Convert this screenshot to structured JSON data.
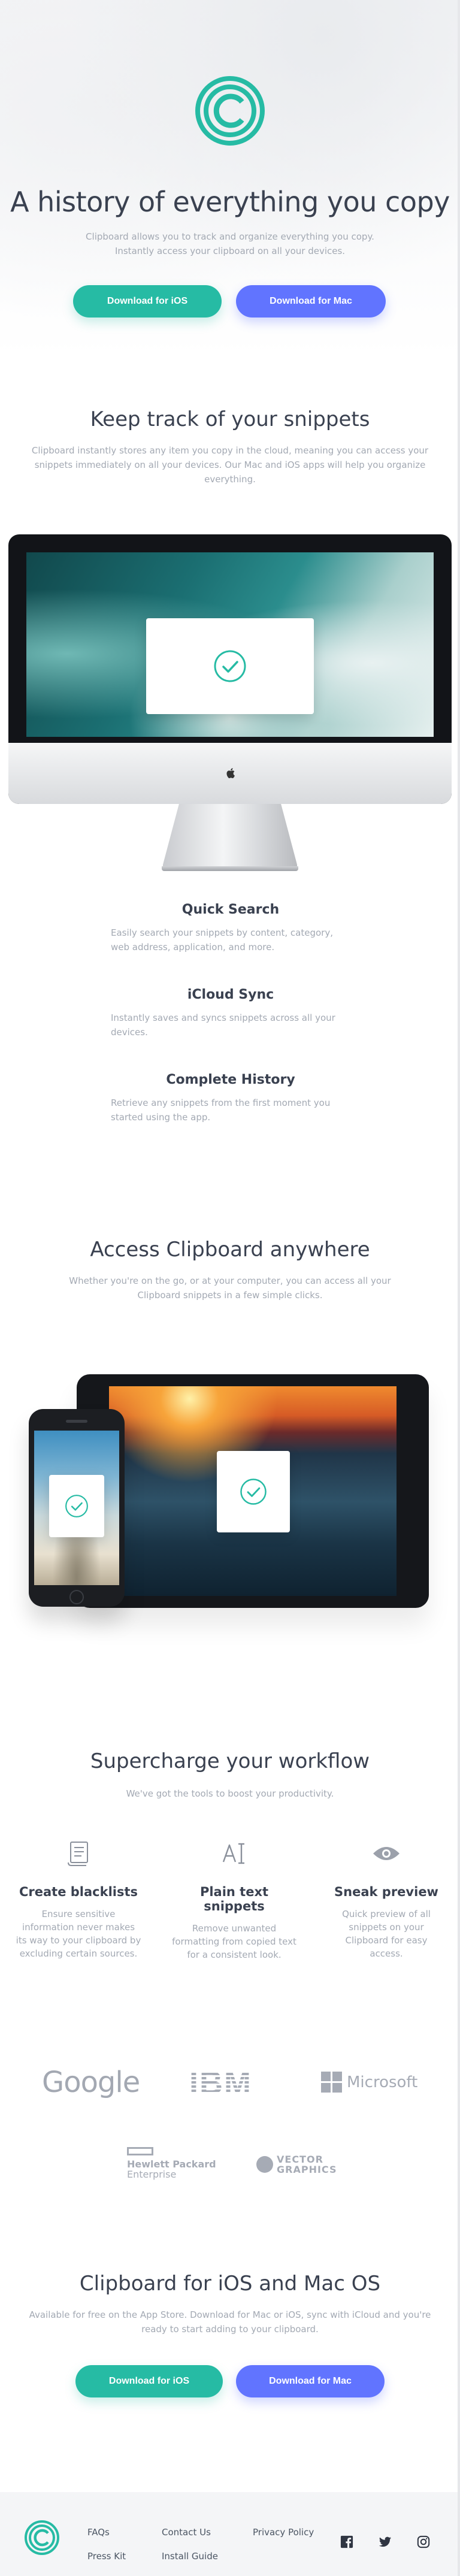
{
  "hero": {
    "title": "A history of everything you copy",
    "subtitle": "Clipboard allows you to track and organize everything you copy. Instantly access your clipboard on all your devices.",
    "ios_button": "Download for iOS",
    "mac_button": "Download for Mac"
  },
  "snippets": {
    "title": "Keep track of your snippets",
    "subtitle": "Clipboard instantly stores any item you copy in the cloud, meaning you can access your snippets immediately on all your devices. Our Mac and iOS apps will help you organize everything.",
    "features": [
      {
        "title": "Quick Search",
        "text": "Easily search your snippets by content, category, web address, application, and more."
      },
      {
        "title": "iCloud Sync",
        "text": "Instantly saves and syncs snippets across all your devices."
      },
      {
        "title": "Complete History",
        "text": "Retrieve any snippets from the first moment you started using the app."
      }
    ]
  },
  "access": {
    "title": "Access Clipboard anywhere",
    "subtitle": "Whether you're on the go, or at your computer, you can access all your Clipboard snippets in a few simple clicks."
  },
  "workflow": {
    "title": "Supercharge your workflow",
    "subtitle": "We've got the tools to boost your productivity.",
    "items": [
      {
        "title": "Create blacklists",
        "text": "Ensure sensitive information never makes its way to your clipboard by excluding certain sources."
      },
      {
        "title": "Plain text snippets",
        "text": "Remove unwanted formatting from copied text for a consistent look."
      },
      {
        "title": "Sneak preview",
        "text": "Quick preview of all snippets on your Clipboard for easy access."
      }
    ]
  },
  "logos": {
    "google": "Google",
    "ibm": "IBM",
    "microsoft": "Microsoft",
    "hpe_line1": "Hewlett Packard",
    "hpe_line2": "Enterprise",
    "vg_line1": "VECTOR",
    "vg_line2": "GRAPHICS"
  },
  "cta": {
    "title": "Clipboard for iOS and Mac OS",
    "subtitle": "Available for free on the App Store. Download for Mac or iOS, sync with iCloud and you're ready to start adding to your clipboard.",
    "ios_button": "Download for iOS",
    "mac_button": "Download for Mac"
  },
  "footer": {
    "links": [
      "FAQs",
      "Contact Us",
      "Privacy Policy",
      "Press Kit",
      "Install Guide"
    ]
  },
  "colors": {
    "accent_green": "#26bba4",
    "accent_blue": "#6174ff",
    "heading": "#3a4150",
    "muted": "#a3a9b3"
  }
}
